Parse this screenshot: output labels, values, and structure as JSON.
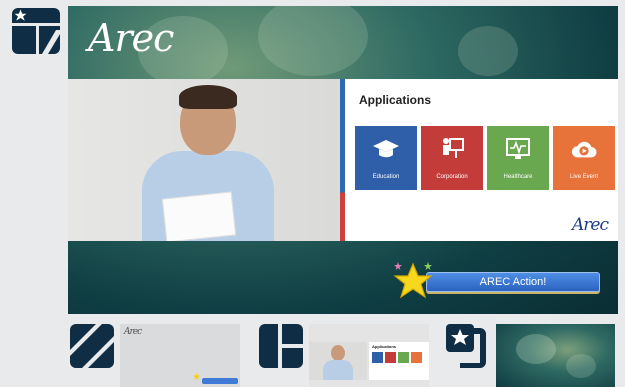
{
  "layout_icons": [
    {
      "name": "layout-star-split-icon"
    },
    {
      "name": "layout-diagonal-stripes-icon"
    },
    {
      "name": "layout-split-columns-icon"
    },
    {
      "name": "layout-star-bracket-icon"
    }
  ],
  "main_preview": {
    "logo": "Arec",
    "slide": {
      "title": "Applications",
      "tiles": [
        {
          "label": "Education",
          "color": "#2f5fa8"
        },
        {
          "label": "Corporation",
          "color": "#c43c3a"
        },
        {
          "label": "Healthcare",
          "color": "#6aa84f"
        },
        {
          "label": "Live Event",
          "color": "#e8733a"
        }
      ],
      "logo": "Arec"
    },
    "action_label": "AREC Action!"
  },
  "thumbnails": [
    {
      "logo": "Arec"
    },
    {
      "title": "Applications"
    },
    {}
  ]
}
